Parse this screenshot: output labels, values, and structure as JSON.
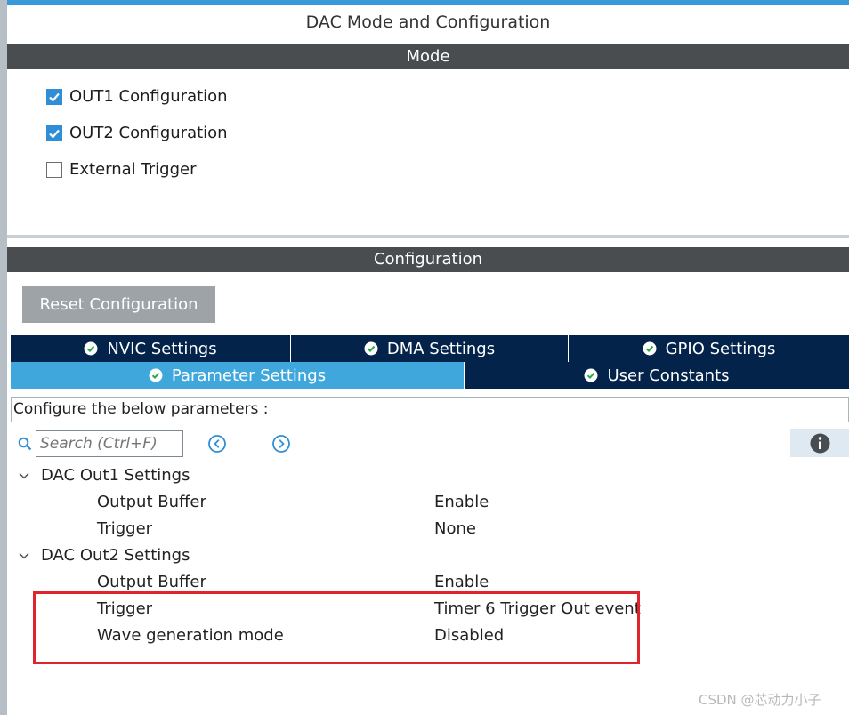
{
  "page": {
    "title": "DAC Mode and Configuration"
  },
  "mode": {
    "header": "Mode",
    "options": [
      {
        "label": "OUT1 Configuration",
        "checked": true
      },
      {
        "label": "OUT2 Configuration",
        "checked": true
      },
      {
        "label": "External Trigger",
        "checked": false
      }
    ]
  },
  "configuration": {
    "header": "Configuration",
    "reset_label": "Reset Configuration",
    "tabs_row1": [
      {
        "label": "NVIC Settings",
        "icon": "check-circle-icon"
      },
      {
        "label": "DMA Settings",
        "icon": "check-circle-icon"
      },
      {
        "label": "GPIO Settings",
        "icon": "check-circle-icon"
      }
    ],
    "tabs_row2": [
      {
        "label": "Parameter Settings",
        "icon": "check-circle-icon",
        "active": true
      },
      {
        "label": "User Constants",
        "icon": "check-circle-icon",
        "active": false
      }
    ],
    "configure_text": "Configure the below parameters :",
    "search": {
      "placeholder": "Search (Ctrl+F)",
      "icon": "search-icon",
      "prev_icon": "chevron-left-circle-icon",
      "next_icon": "chevron-right-circle-icon",
      "info_icon": "info-icon"
    },
    "groups": [
      {
        "title": "DAC Out1 Settings",
        "params": [
          {
            "name": "Output Buffer",
            "value": "Enable"
          },
          {
            "name": "Trigger",
            "value": "None"
          }
        ]
      },
      {
        "title": "DAC Out2 Settings",
        "params": [
          {
            "name": "Output Buffer",
            "value": "Enable"
          },
          {
            "name": "Trigger",
            "value": "Timer 6 Trigger Out event"
          },
          {
            "name": "Wave generation mode",
            "value": "Disabled"
          }
        ]
      }
    ]
  },
  "watermark": "CSDN @芯动力小子",
  "colors": {
    "header_bg": "#4a4d50",
    "tab_dark": "#03234b",
    "tab_active": "#3fa7dc",
    "checkbox": "#2f8ed6",
    "highlight": "#e0242d"
  }
}
